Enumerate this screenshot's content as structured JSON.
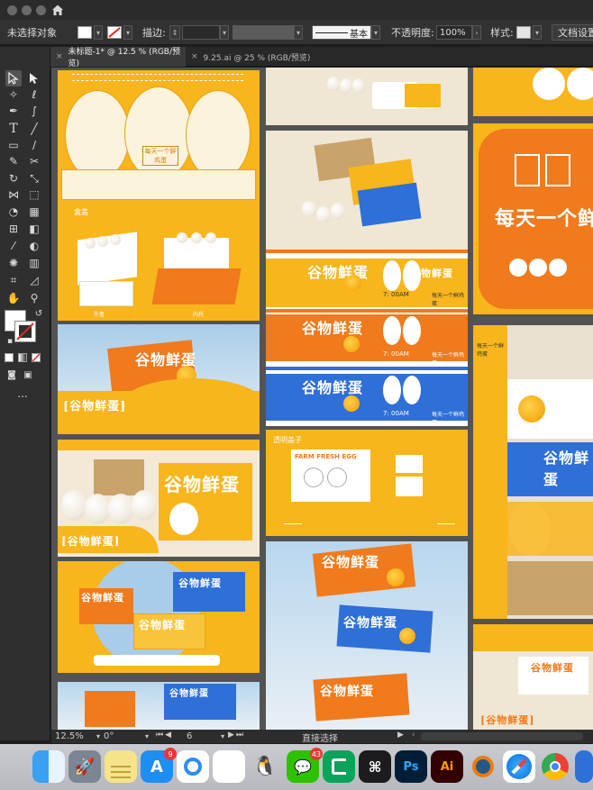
{
  "control_bar": {
    "selection_status": "未选择对象",
    "stroke_label": "描边:",
    "brush_name": "基本",
    "opacity_label": "不透明度:",
    "opacity_value": "100%",
    "style_label": "样式:",
    "doc_settings_button": "文档设置"
  },
  "tabs": [
    {
      "label": "未标题-1* @ 12.5 % (RGB/预览)",
      "active": true
    },
    {
      "label": "9.25.ai @ 25 % (RGB/预览)",
      "active": false
    }
  ],
  "toolbar": {
    "more_tools": "..."
  },
  "artboards": {
    "brand_name": "谷物鲜蛋",
    "brand_bracketed": "[谷物鲜蛋]",
    "slogan": "每天一个鲜鸡蛋",
    "slogan_short": "每天一个鲜",
    "time_label": "7: 00AM",
    "transparent_lid_label": "透明盖子",
    "farm_fresh_egg": "FARM FRESH EGG",
    "dieline_top_label": "盒盖",
    "dieline_bottom_labels": [
      "外盒",
      "内托"
    ]
  },
  "status_bar": {
    "zoom": "12.5%",
    "rotation": "0°",
    "artboard_number": "6",
    "current_tool": "直接选择"
  },
  "dock": {
    "app_store_badge": "9",
    "wechat_badge": "43",
    "photoshop_label": "Ps",
    "illustrator_label": "Ai"
  },
  "colors": {
    "brand_yellow": "#f8b51c",
    "brand_orange": "#f07a1c",
    "brand_blue": "#2f6fd8",
    "sky_blue": "#a9cde8"
  }
}
